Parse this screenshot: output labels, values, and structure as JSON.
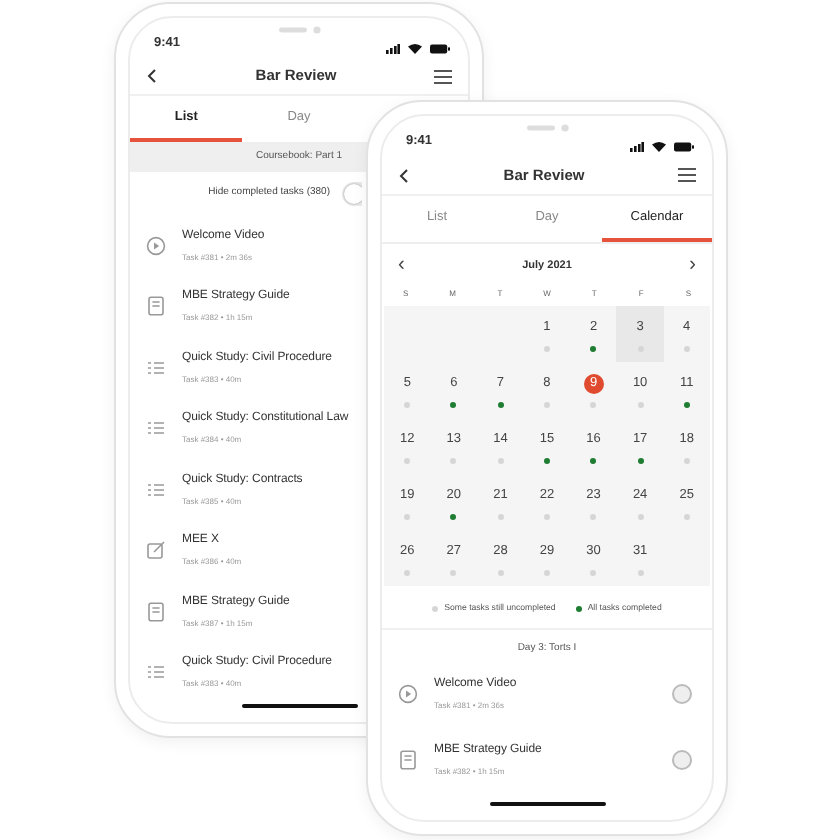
{
  "phones": [
    {
      "status_time": "9:41",
      "title": "Bar Review",
      "tabs": [
        {
          "label": "List",
          "selected": true
        },
        {
          "label": "Day",
          "selected": false
        }
      ],
      "section": "Coursebook: Part 1",
      "hide_completed": {
        "label": "Hide completed tasks (380)",
        "on": false
      },
      "tasks": [
        {
          "kind": "video",
          "title": "Welcome Video",
          "meta": "Task #381 • 2m 36s"
        },
        {
          "kind": "reading",
          "title": "MBE Strategy Guide",
          "meta": "Task #382 • 1h 15m"
        },
        {
          "kind": "study",
          "title": "Quick Study: Civil Procedure",
          "meta": "Task #383 • 40m"
        },
        {
          "kind": "study",
          "title": "Quick Study: Constitutional Law",
          "meta": "Task #384 • 40m"
        },
        {
          "kind": "study",
          "title": "Quick Study: Contracts",
          "meta": "Task #385 • 40m"
        },
        {
          "kind": "essay",
          "title": "MEE X",
          "meta": "Task #386 • 40m"
        },
        {
          "kind": "reading",
          "title": "MBE Strategy Guide",
          "meta": "Task #387 • 1h 15m"
        },
        {
          "kind": "study",
          "title": "Quick Study: Civil Procedure",
          "meta": "Task #383 • 40m"
        }
      ]
    },
    {
      "status_time": "9:41",
      "title": "Bar Review",
      "tabs": [
        {
          "label": "List",
          "selected": false
        },
        {
          "label": "Day",
          "selected": false
        },
        {
          "label": "Calendar",
          "selected": true
        }
      ],
      "calendar": {
        "month": "July 2021",
        "prev": "‹",
        "next": "›",
        "weekdays": [
          "S",
          "M",
          "T",
          "W",
          "T",
          "F",
          "S"
        ],
        "days": [
          {
            "day": "1",
            "done": false,
            "selected": false,
            "today": false
          },
          {
            "day": "2",
            "done": true,
            "selected": false,
            "today": false
          },
          {
            "day": "3",
            "done": false,
            "selected": true,
            "today": false
          },
          {
            "day": "4",
            "done": false,
            "selected": false,
            "today": false
          },
          {
            "day": "5",
            "done": false,
            "selected": false,
            "today": false
          },
          {
            "day": "6",
            "done": true,
            "selected": false,
            "today": false
          },
          {
            "day": "7",
            "done": true,
            "selected": false,
            "today": false
          },
          {
            "day": "8",
            "done": false,
            "selected": false,
            "today": false
          },
          {
            "day": "9",
            "done": false,
            "selected": false,
            "today": true
          },
          {
            "day": "10",
            "done": false,
            "selected": false,
            "today": false
          },
          {
            "day": "11",
            "done": true,
            "selected": false,
            "today": false
          },
          {
            "day": "12",
            "done": false,
            "selected": false,
            "today": false
          },
          {
            "day": "13",
            "done": false,
            "selected": false,
            "today": false
          },
          {
            "day": "14",
            "done": false,
            "selected": false,
            "today": false
          },
          {
            "day": "15",
            "done": true,
            "selected": false,
            "today": false
          },
          {
            "day": "16",
            "done": true,
            "selected": false,
            "today": false
          },
          {
            "day": "17",
            "done": true,
            "selected": false,
            "today": false
          },
          {
            "day": "18",
            "done": false,
            "selected": false,
            "today": false
          },
          {
            "day": "19",
            "done": false,
            "selected": false,
            "today": false
          },
          {
            "day": "20",
            "done": true,
            "selected": false,
            "today": false
          },
          {
            "day": "21",
            "done": false,
            "selected": false,
            "today": false
          },
          {
            "day": "22",
            "done": false,
            "selected": false,
            "today": false
          },
          {
            "day": "23",
            "done": false,
            "selected": false,
            "today": false
          },
          {
            "day": "24",
            "done": false,
            "selected": false,
            "today": false
          },
          {
            "day": "25",
            "done": false,
            "selected": false,
            "today": false
          },
          {
            "day": "26",
            "done": false,
            "selected": false,
            "today": false
          },
          {
            "day": "27",
            "done": false,
            "selected": false,
            "today": false
          },
          {
            "day": "28",
            "done": false,
            "selected": false,
            "today": false
          },
          {
            "day": "29",
            "done": false,
            "selected": false,
            "today": false
          },
          {
            "day": "30",
            "done": false,
            "selected": false,
            "today": false
          },
          {
            "day": "31",
            "done": false,
            "selected": false,
            "today": false
          }
        ],
        "legend": [
          {
            "label": "Some tasks still uncompleted",
            "done": false
          },
          {
            "label": "All tasks completed",
            "done": true
          }
        ]
      },
      "day_heading": "Day 3: Torts I",
      "tasks": [
        {
          "kind": "video",
          "title": "Welcome Video",
          "meta": "Task #381 • 2m 36s",
          "checked": false
        },
        {
          "kind": "reading",
          "title": "MBE Strategy Guide",
          "meta": "Task #382 • 1h 15m",
          "checked": false
        }
      ]
    }
  ]
}
